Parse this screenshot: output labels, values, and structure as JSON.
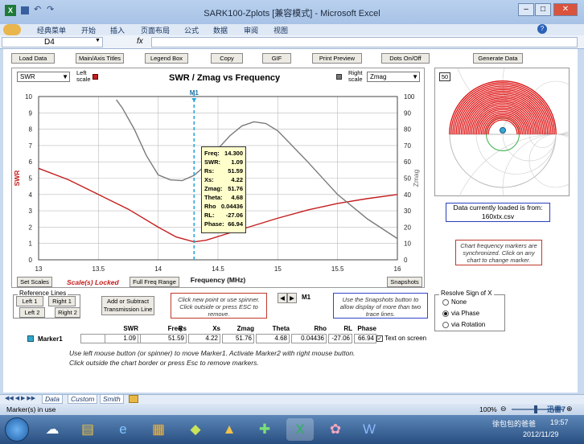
{
  "window": {
    "title": "SARK100-Zplots  [兼容模式] - Microsoft Excel",
    "window_title_fmt": "SARK100-Zplots  [兼容模式] - Microsoft Excel"
  },
  "ribbon": {
    "tabs": [
      "经典菜单",
      "开始",
      "插入",
      "页面布局",
      "公式",
      "数据",
      "审阅",
      "视图"
    ]
  },
  "formula": {
    "namebox": "D4",
    "fx": "fx",
    "value": ""
  },
  "toolbar": {
    "buttons": [
      "Load Data",
      "Main/Axis Titles",
      "Legend Box",
      "Copy",
      "GIF",
      "Print Preview",
      "Dots On/Off",
      "Generate Data"
    ]
  },
  "chart": {
    "left_select": "SWR",
    "left_scale_label": "Left scale",
    "right_select": "Zmag",
    "right_scale_label": "Right scale",
    "marker_label": "M1",
    "scale_locked": "Scale(s) Locked",
    "tip": [
      [
        "Freq:",
        "14.300"
      ],
      [
        "SWR:",
        "1.09"
      ],
      [
        "Rs:",
        "51.59"
      ],
      [
        "Xs:",
        "4.22"
      ],
      [
        "Zmag:",
        "51.76"
      ],
      [
        "Theta:",
        "4.68"
      ],
      [
        "Rho",
        "0.04436"
      ],
      [
        "RL:",
        "-27.06"
      ],
      [
        "Phase:",
        "66.94"
      ]
    ]
  },
  "chart_data": {
    "type": "line",
    "title": "SWR / Zmag  vs  Frequency",
    "xlabel": "Frequency (MHz)",
    "ylabel": "SWR",
    "y2label": "Zmag",
    "xlim": [
      13,
      16
    ],
    "ylim": [
      0,
      10
    ],
    "y2lim": [
      0,
      100
    ],
    "xticks": [
      "13",
      "13.5",
      "14",
      "14.5",
      "15",
      "15.5",
      "16"
    ],
    "yticks": [
      "0",
      "1",
      "2",
      "3",
      "4",
      "5",
      "6",
      "7",
      "8",
      "9",
      "10"
    ],
    "y2ticks": [
      "0",
      "10",
      "20",
      "30",
      "40",
      "50",
      "60",
      "70",
      "80",
      "90",
      "100"
    ],
    "marker_x": 14.3,
    "series": [
      {
        "name": "SWR",
        "color": "#c41d1d",
        "axis": "left",
        "x": [
          13,
          13.25,
          13.5,
          13.75,
          14,
          14.15,
          14.3,
          14.4,
          14.6,
          14.8,
          15,
          15.25,
          15.5,
          15.75,
          16
        ],
        "y": [
          5.6,
          4.9,
          4.0,
          3.1,
          2.0,
          1.4,
          1.1,
          1.2,
          1.65,
          2.1,
          2.55,
          3.05,
          3.45,
          3.75,
          4.0
        ]
      },
      {
        "name": "Zmag",
        "color": "#7a7a7a",
        "axis": "right",
        "x": [
          13.65,
          13.7,
          13.8,
          13.9,
          14,
          14.1,
          14.2,
          14.3,
          14.4,
          14.5,
          14.6,
          14.7,
          14.8,
          14.9,
          15,
          15.25,
          15.5,
          15.75,
          16
        ],
        "y": [
          98,
          93,
          80,
          64,
          52,
          49,
          48.5,
          51.7,
          58,
          68,
          76,
          82,
          84.5,
          83.5,
          79,
          60,
          40,
          25,
          13
        ]
      }
    ]
  },
  "chart_buttons": {
    "set_scales": "Set Scales",
    "freq_range": "Full Freq Range",
    "snapshots": "Snapshots"
  },
  "smith": {
    "counter": "50"
  },
  "info": {
    "loaded": "Data currently  loaded is from:",
    "file": "160xtx.csv",
    "sync_note": "Chart frequency markers are synchronized.  Click on any chart to change marker."
  },
  "reference": {
    "title": "Reference Lines",
    "left1": "Left 1",
    "right1": "Right 1",
    "left2": "Left 2",
    "right2": "Right 2"
  },
  "add_sub": "Add or Subtract Transmission Line",
  "click_note": "Click new point or use spinner.  Click outside or press ESC to remove.",
  "spinner": {
    "label": "M1"
  },
  "snap_note": "Use the Snapshots button to allow display of more than two trace lines.",
  "resolve": {
    "title": "Resolve Sign of X",
    "opts": [
      "None",
      "via Phase",
      "via Rotation"
    ]
  },
  "table": {
    "row_label": "Marker1",
    "headers": [
      "Freq",
      "SWR",
      "Rs",
      "Xs",
      "Zmag",
      "Theta",
      "Rho",
      "RL",
      "Phase"
    ],
    "values": [
      "14.300",
      "1.09",
      "51.59",
      "4.22",
      "51.76",
      "4.68",
      "0.04436",
      "-27.06",
      "66.94"
    ],
    "text_on_screen": "Text on screen"
  },
  "help": {
    "line1": "Use left mouse button (or spinner) to move Marker1.  Activate Marker2 with right mouse button.",
    "line2": "Click outside the chart border or press Esc to remove markers."
  },
  "sheets": [
    "Data",
    "Custom",
    "Smith"
  ],
  "status": {
    "text": "Marker(s) in use",
    "zoom": "100%"
  },
  "taskbar": {
    "clock_name": "徐包包的爸爸",
    "time": "19:57",
    "date": "2012/11/29",
    "tray": "迅雷7"
  }
}
